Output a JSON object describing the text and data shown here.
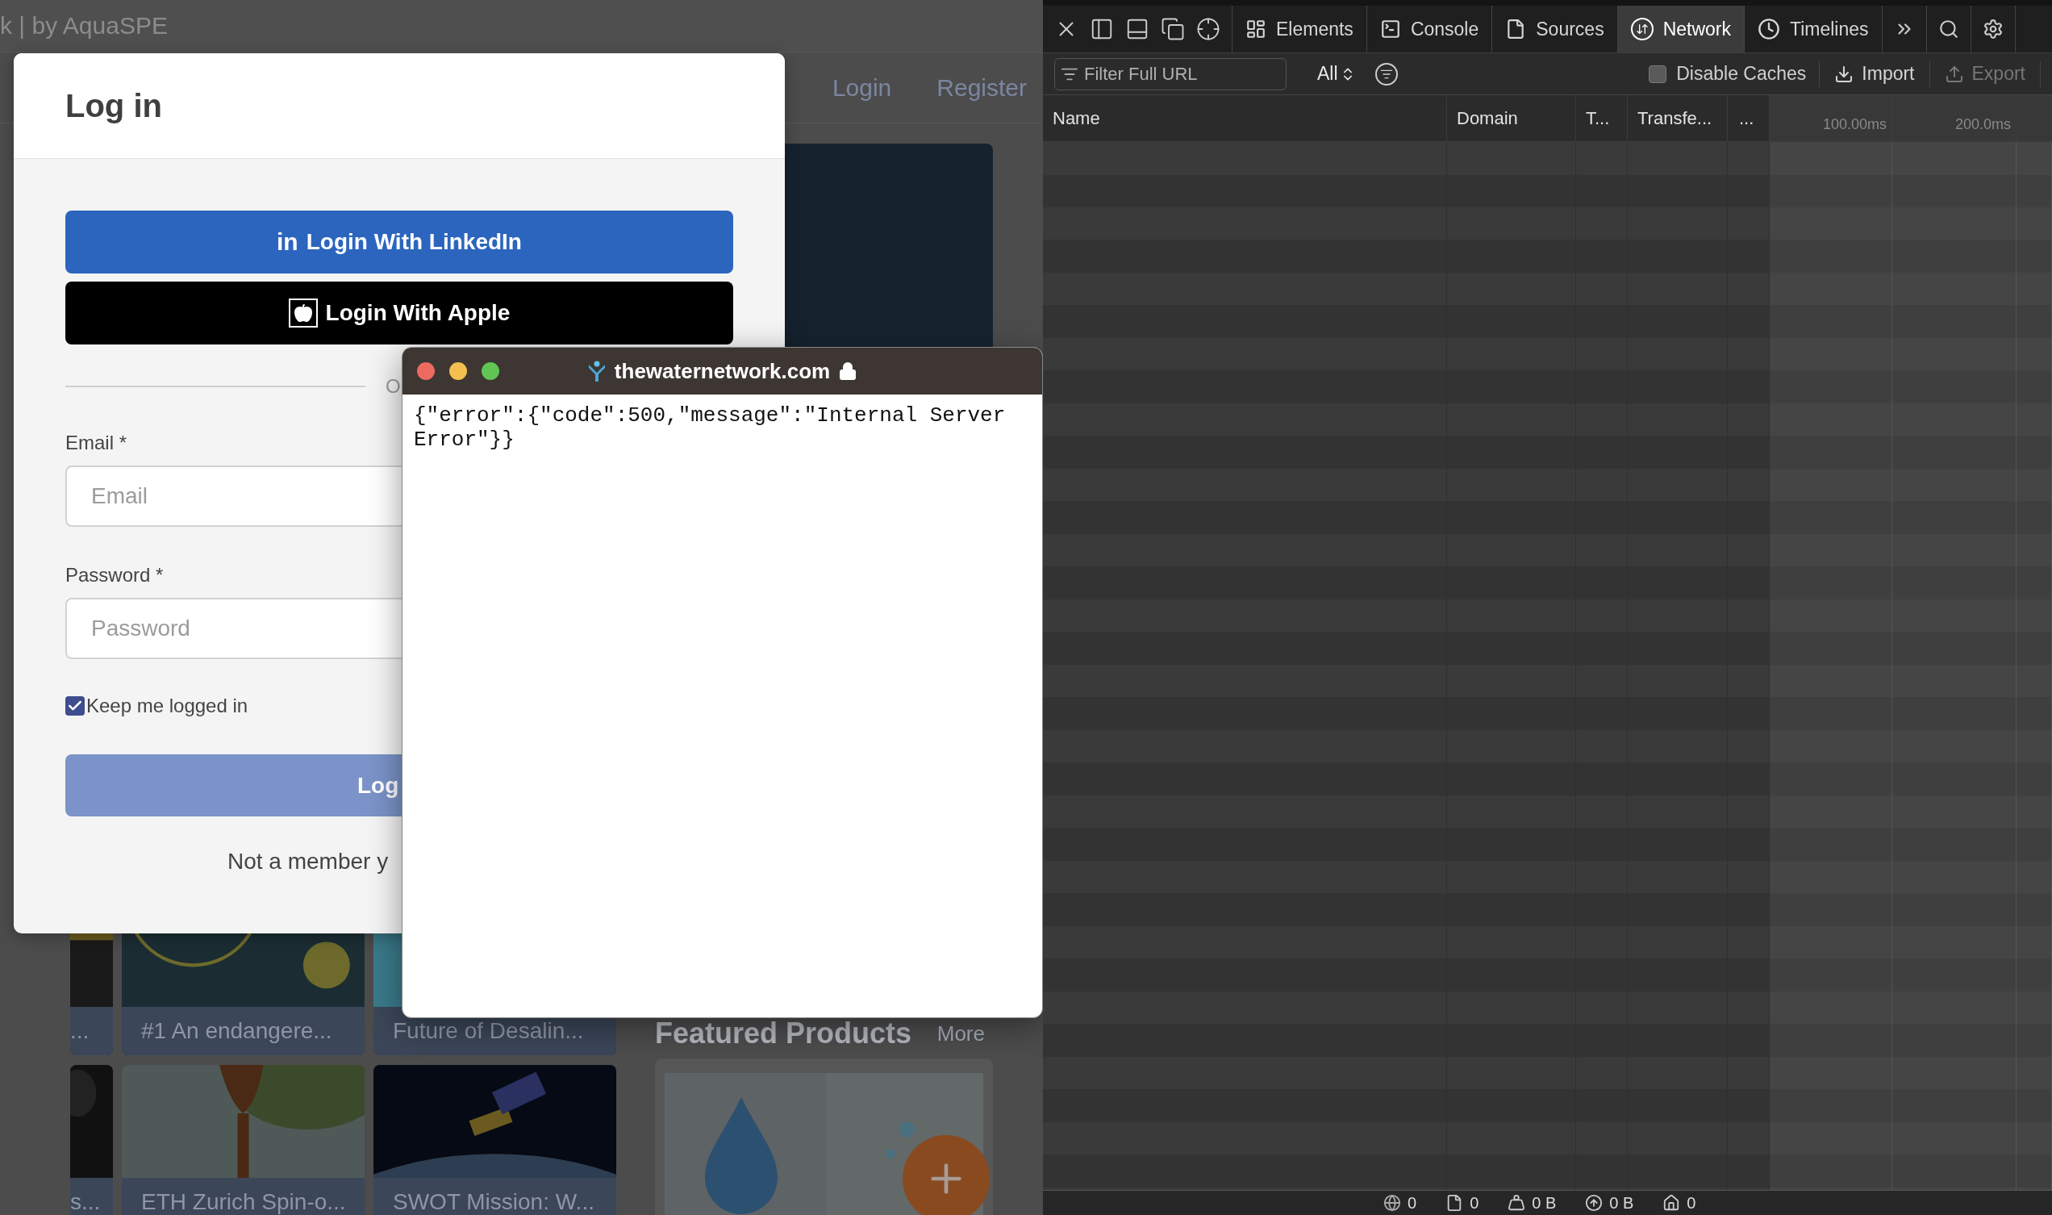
{
  "page": {
    "title": "k | by AquaSPE",
    "nav": [
      {
        "label": "Login"
      },
      {
        "label": "Register"
      }
    ],
    "cards": [
      {
        "title": "..."
      },
      {
        "title": "#1 An endangere..."
      },
      {
        "title": "Future of Desalin..."
      },
      {
        "title": "s..."
      },
      {
        "title": "ETH Zurich Spin-o..."
      },
      {
        "title": "SWOT Mission: W..."
      }
    ],
    "featured": {
      "heading": "Featured Products",
      "more": "More"
    }
  },
  "modal": {
    "title": "Log in",
    "sso_buttons": [
      {
        "kind": "linkedin",
        "logo": "in",
        "label": "Login With LinkedIn"
      },
      {
        "kind": "apple",
        "label": "Login With Apple"
      }
    ],
    "divider": "O",
    "fields": [
      {
        "label": "Email *",
        "placeholder": "Email"
      },
      {
        "label": "Password *",
        "placeholder": "Password"
      }
    ],
    "remember": {
      "label": "Keep me logged in",
      "checked": true
    },
    "submit": "Log",
    "signup": "Not a member y"
  },
  "popup": {
    "title": "thewaternetwork.com",
    "body": "{\"error\":{\"code\":500,\"message\":\"Internal Server Error\"}}"
  },
  "devtools": {
    "tabs": [
      {
        "kind": "elements",
        "label": "Elements",
        "selected": false
      },
      {
        "kind": "console",
        "label": "Console",
        "selected": false
      },
      {
        "kind": "sources",
        "label": "Sources",
        "selected": false
      },
      {
        "kind": "network",
        "label": "Network",
        "selected": true
      },
      {
        "kind": "timelines",
        "label": "Timelines",
        "selected": false
      }
    ],
    "filter": {
      "placeholder": "Filter Full URL"
    },
    "type_filter": "All",
    "disable_caches": {
      "label": "Disable Caches",
      "checked": false
    },
    "actions": [
      {
        "kind": "import",
        "label": "Import",
        "disabled": false
      },
      {
        "kind": "export",
        "label": "Export",
        "disabled": true
      }
    ],
    "columns": [
      "Name",
      "Domain",
      "T...",
      "Transfe...",
      "..."
    ],
    "timeline_ticks": [
      "100.00ms",
      "200.0ms"
    ],
    "status": [
      {
        "kind": "globe",
        "text": "0"
      },
      {
        "kind": "document",
        "text": "0"
      },
      {
        "kind": "weight",
        "text": "0 B"
      },
      {
        "kind": "upload",
        "text": "0 B"
      },
      {
        "kind": "home",
        "text": "0"
      }
    ]
  }
}
